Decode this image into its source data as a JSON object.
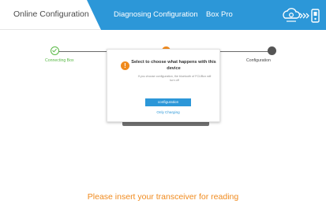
{
  "header": {
    "tabs": [
      {
        "label": "Online Configuration",
        "active": true
      },
      {
        "label": "Diagnosing Configuration",
        "active": false
      },
      {
        "label": "Box Pro",
        "active": false
      }
    ],
    "icons": [
      "cloud-settings-icon",
      "signal-arrows-icon",
      "device-icon"
    ]
  },
  "stepper": {
    "steps": [
      {
        "label": "Connecting Box",
        "state": "completed"
      },
      {
        "label": "",
        "state": "active"
      },
      {
        "label": "Configuration",
        "state": "pending"
      }
    ]
  },
  "dialog": {
    "title": "Select to choose what happens with this device",
    "body": "If you choose configuration, the bluetooth of FCUBox will turn off",
    "primary_button": "configuration",
    "secondary_link": "Only Charging",
    "icon": "warning-icon"
  },
  "footer": {
    "message": "Please insert your transceiver for reading"
  },
  "colors": {
    "brand_blue": "#2c97d8",
    "accent_orange": "#f08a1d",
    "success_green": "#5ab947"
  }
}
